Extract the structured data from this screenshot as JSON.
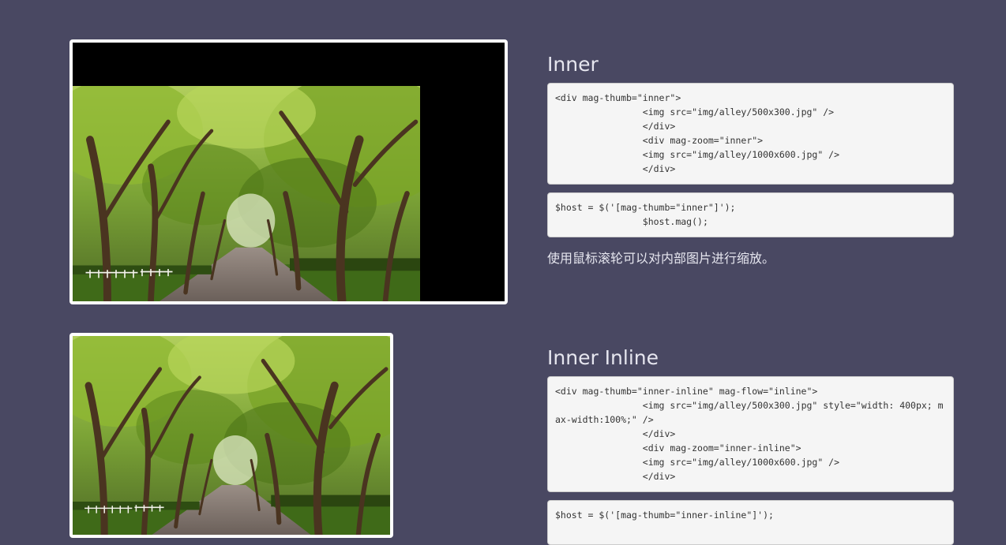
{
  "sections": [
    {
      "title": "Inner",
      "html_code": "<div mag-thumb=\"inner\">\n                <img src=\"img/alley/500x300.jpg\" />\n                </div>\n                <div mag-zoom=\"inner\">\n                <img src=\"img/alley/1000x600.jpg\" />\n                </div>",
      "js_code": "$host = $('[mag-thumb=\"inner\"]');\n                $host.mag();",
      "description": "使用鼠标滚轮可以对内部图片进行缩放。"
    },
    {
      "title": "Inner Inline",
      "html_code": "<div mag-thumb=\"inner-inline\" mag-flow=\"inline\">\n                <img src=\"img/alley/500x300.jpg\" style=\"width: 400px; max-width:100%;\" />\n                </div>\n                <div mag-zoom=\"inner-inline\">\n                <img src=\"img/alley/1000x600.jpg\" />\n                </div>",
      "js_code": "$host = $('[mag-thumb=\"inner-inline\"]');"
    }
  ],
  "colors": {
    "page_background": "#494862",
    "frame": "#ffffff",
    "code_background": "#f5f5f5",
    "code_text": "#333333",
    "heading_text": "#e6e6ef"
  },
  "images": [
    {
      "subject": "tree-lined alley photo",
      "icon": "alley-photo"
    },
    {
      "subject": "tree-lined alley photo",
      "icon": "alley-photo"
    }
  ]
}
